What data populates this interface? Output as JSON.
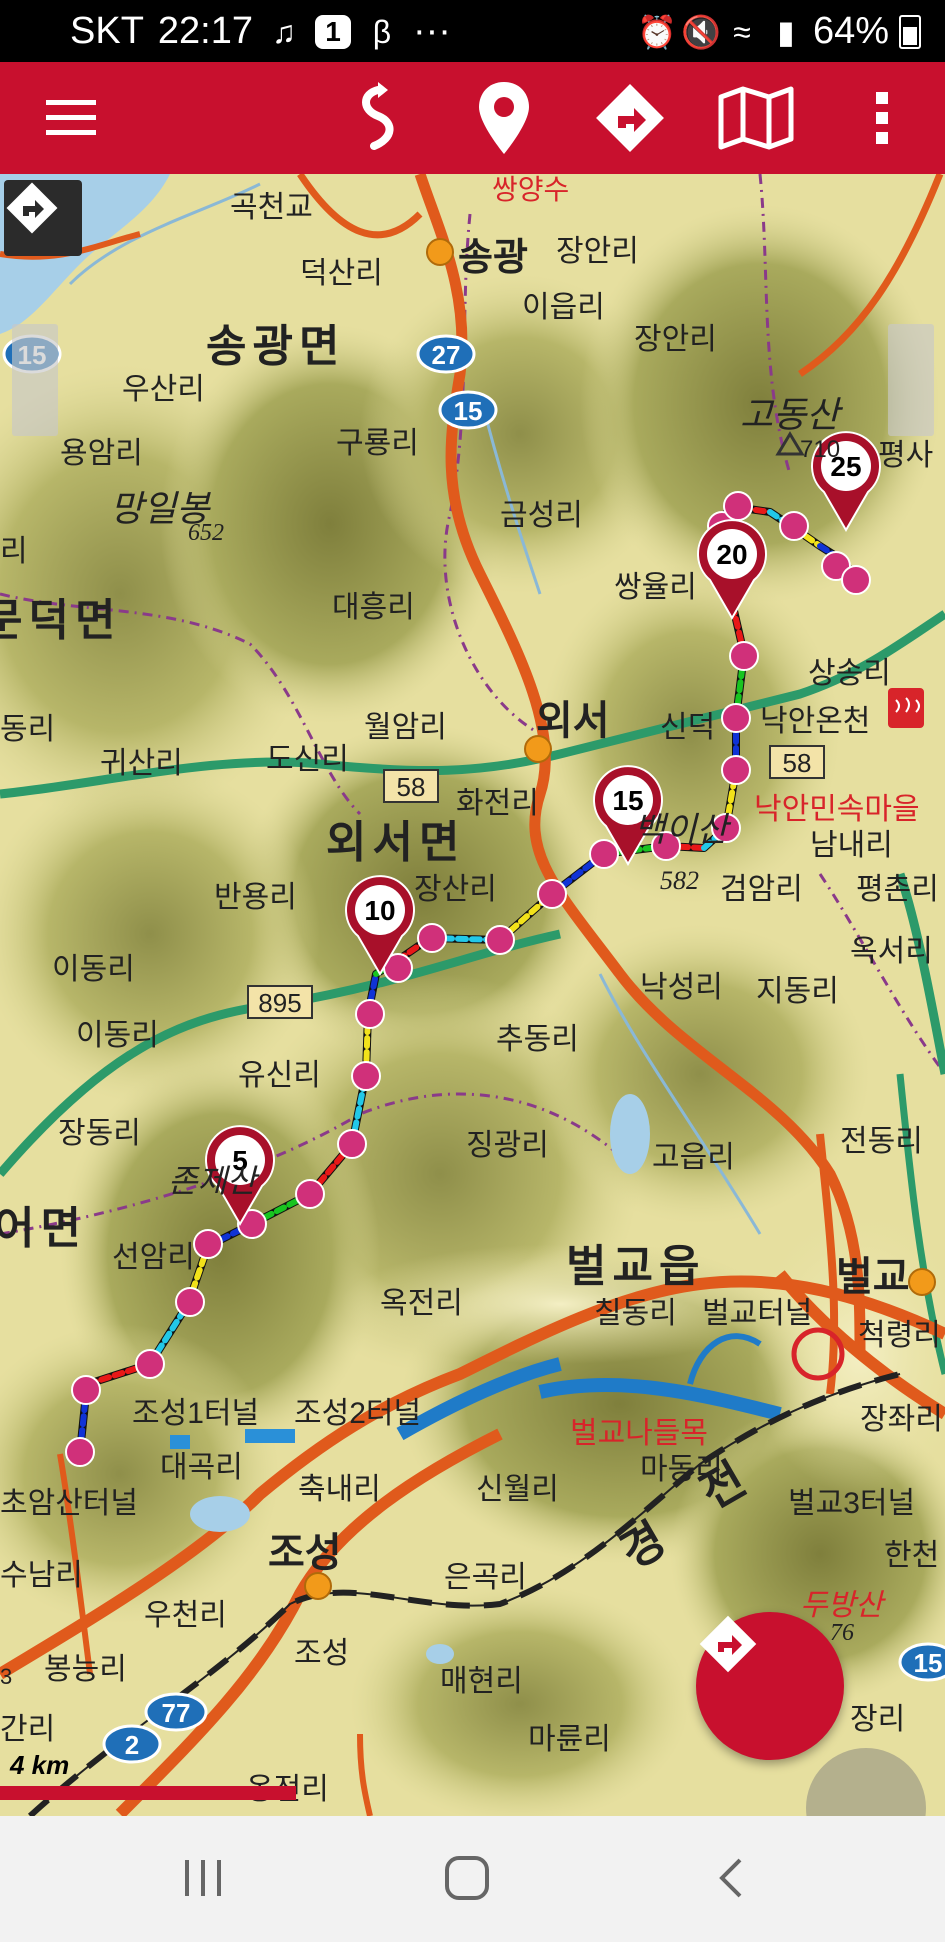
{
  "status_bar": {
    "carrier": "SKT",
    "time": "22:17",
    "notif_badge": "1",
    "more": "···",
    "battery": "64%"
  },
  "toolbar": {
    "icons": [
      "menu-icon",
      "route-icon",
      "location-pin-icon",
      "directions-icon",
      "map-icon",
      "more-vert-icon"
    ]
  },
  "map": {
    "labels": {
      "goncheongyo": "곡천교",
      "songgwang_top": "쌍양수",
      "songgwang": "송광",
      "jangan": "장안리",
      "deoksan": "덕산리",
      "iup": "이읍리",
      "songgwang_myeon": "송광면",
      "jangan2": "장안리",
      "godongsan": "고동산",
      "godongsan_h": "710",
      "pyeongsa": "평사",
      "usan": "우산리",
      "yongam": "용암리",
      "guryong": "구룡리",
      "mangilbong": "망일봉",
      "mangilbong_h": "652",
      "geumseong": "금성리",
      "ssangyul": "쌍율리",
      "ri_left": "리",
      "deokmyeon": "문덕면",
      "daeheung": "대흥리",
      "sangsong": "상송리",
      "dongri": "동리",
      "gwisan": "귀산리",
      "dosin": "도신리",
      "wolam": "월암리",
      "oeseo": "외서",
      "sindeok": "신덕",
      "nagan_oncheon": "낙안온천",
      "hwajeon": "화전리",
      "folk_village": "낙안민속마을",
      "oeseo_myeon": "외서면",
      "namnae": "남내리",
      "banyong": "반용리",
      "jangsan": "장산리",
      "baegisan": "백이산",
      "baegisan_h": "582",
      "geomam": "검암리",
      "pyeongchon": "평촌리",
      "idong": "이동리",
      "ogseo": "옥서리",
      "nakseong": "낙성리",
      "jidong": "지동리",
      "idong2": "이동리",
      "chudong": "추동리",
      "yusin": "유신리",
      "jeondong": "전동리",
      "jangdong": "장동리",
      "jinggwang": "징광리",
      "goeup": "고읍리",
      "jonje": "존제산",
      "eomyeon": "어면",
      "seonam": "선암리",
      "beolgyo_eup": "벌교읍",
      "beolgyo": "벌교",
      "ogjeon": "옥전리",
      "childong": "칠동리",
      "beolgyo_tunnel": "벌교터널",
      "cheongnyong": "척령리",
      "joseong1": "조성1터널",
      "joseong2": "조성2터널",
      "beolgyo_ic": "벌교나들목",
      "jangjwa": "장좌리",
      "daegok": "대곡리",
      "madong": "마동리",
      "chuknae": "축내리",
      "sinwol": "신월리",
      "beolgyo3": "벌교3터널",
      "choamsan": "초암산터널",
      "gyeongjeon_gyeong": "경",
      "gyeongjeon_jeon": "전",
      "hancheon": "한천",
      "sunam": "수남리",
      "joseong": "조성",
      "eungok": "은곡리",
      "jugye": "두방산",
      "ucheon": "우천리",
      "joseong_st": "조성",
      "maehyeon": "매현리",
      "bongneung": "봉능리",
      "jangri": "장리",
      "ganri": "간리",
      "maryun": "마륜리",
      "ongjeon": "옹전리",
      "num3": "3",
      "num76": "76"
    },
    "road_shields": {
      "r15_left": "15",
      "r27": "27",
      "r15": "15",
      "r58": "58",
      "r58b": "58",
      "r895": "895",
      "r77": "77",
      "r2": "2",
      "r15_right": "15"
    },
    "waypoint_pins": [
      "5",
      "10",
      "15",
      "20",
      "25"
    ],
    "scale_label": "4 km"
  },
  "colors": {
    "brand_red": "#c8102e",
    "waypoint_dot": "#d0307a",
    "route_line_a": "#1033d6",
    "route_line_b": "#18c420",
    "route_line_c": "#e81818"
  }
}
